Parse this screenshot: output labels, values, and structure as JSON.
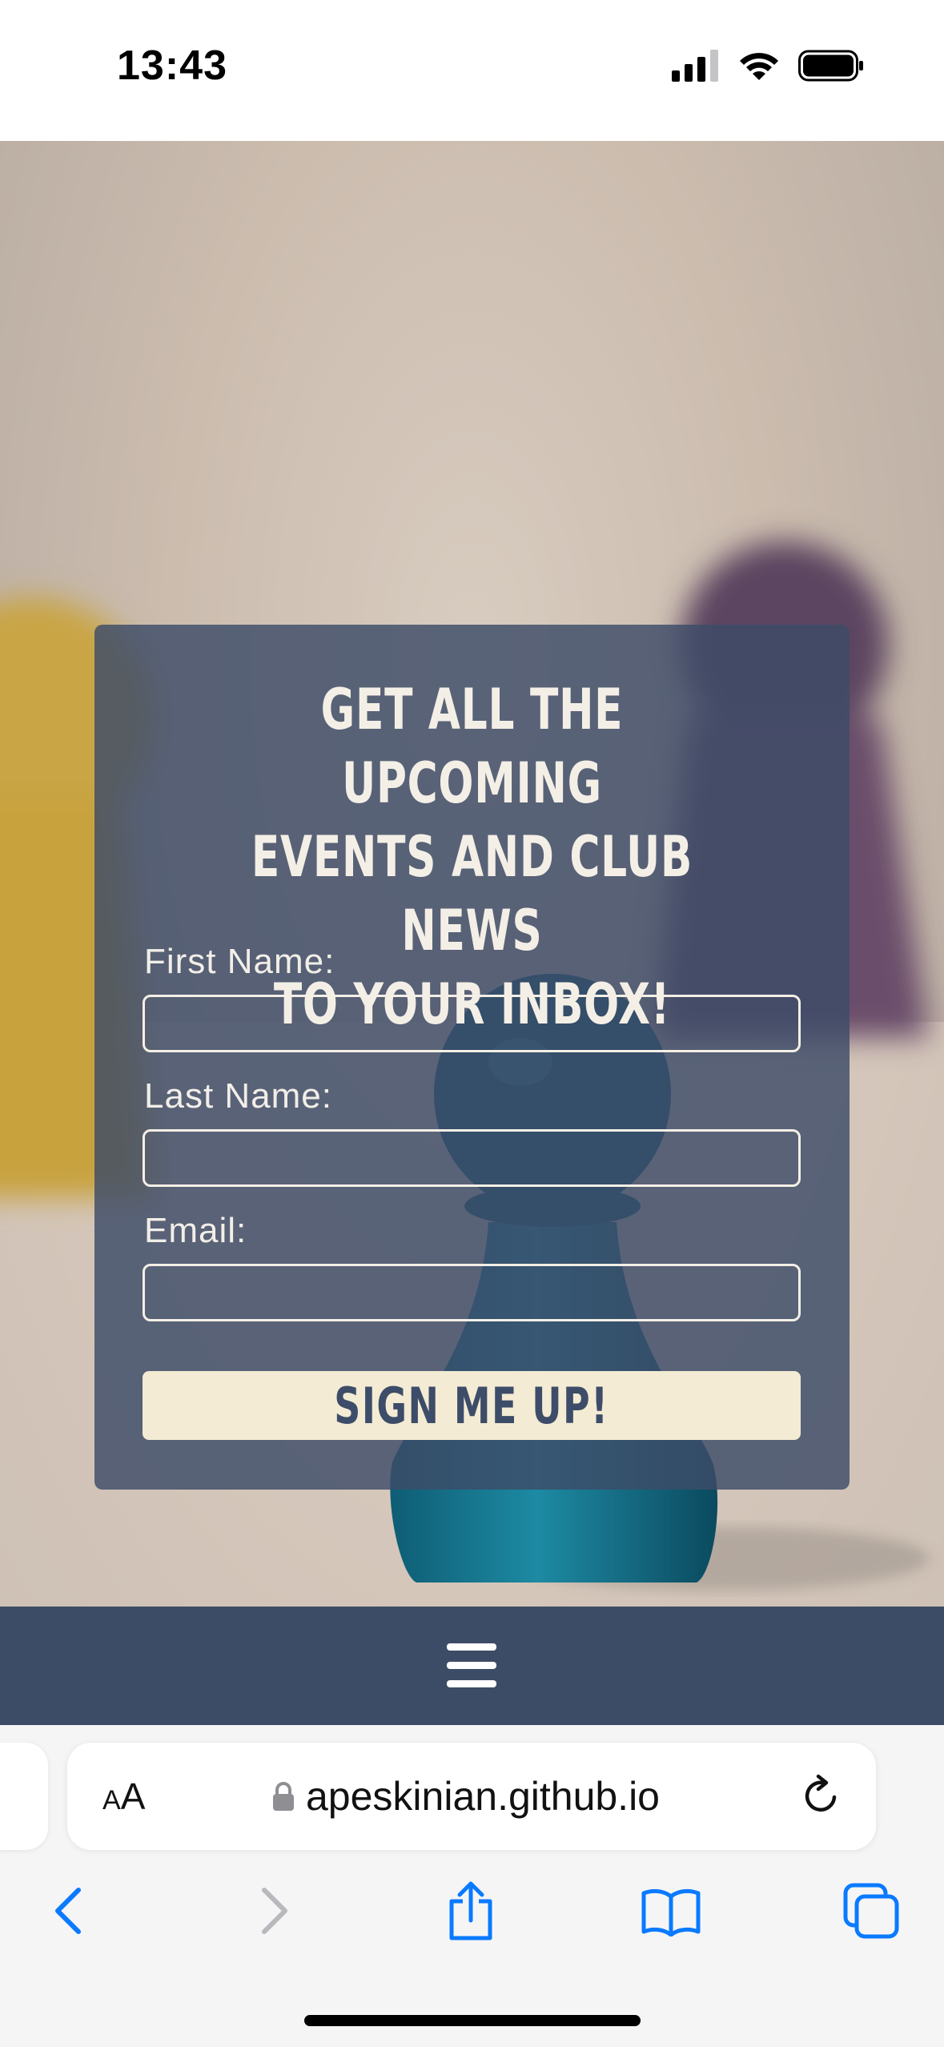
{
  "status_bar": {
    "time": "13:43",
    "icons": [
      "cellular-signal-icon",
      "wifi-icon",
      "battery-icon"
    ]
  },
  "signup_form": {
    "heading_lines": [
      "GET ALL THE UPCOMING",
      "EVENTS AND CLUB NEWS",
      "TO YOUR INBOX!"
    ],
    "fields": [
      {
        "label": "First Name:",
        "value": ""
      },
      {
        "label": "Last Name:",
        "value": ""
      },
      {
        "label": "Email:",
        "value": ""
      }
    ],
    "submit_label": "SIGN ME UP!"
  },
  "nav": {
    "menu_icon": "hamburger-menu-icon"
  },
  "browser": {
    "text_size_label_small": "A",
    "text_size_label_large": "A",
    "url": "apeskinian.github.io",
    "toolbar": [
      "back-icon",
      "forward-icon",
      "share-icon",
      "bookmarks-icon",
      "tabs-icon"
    ]
  },
  "colors": {
    "card_overlay": "#3d4c68",
    "button_bg": "#f3ebd3",
    "nav_bg": "#3d4c66",
    "ios_blue": "#0a7aff"
  }
}
